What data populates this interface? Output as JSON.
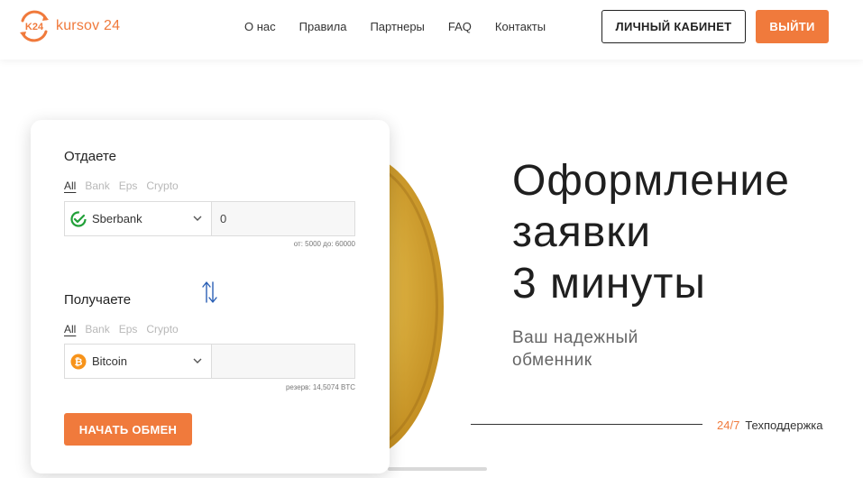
{
  "header": {
    "logo_badge": "K24",
    "logo_text": "kursov 24",
    "nav": [
      "О нас",
      "Правила",
      "Партнеры",
      "FAQ",
      "Контакты"
    ],
    "cabinet_label": "ЛИЧНЫЙ КАБИНЕТ",
    "logout_label": "ВЫЙТИ"
  },
  "exchange": {
    "give": {
      "title": "Отдаете",
      "tabs": [
        "All",
        "Bank",
        "Eps",
        "Crypto"
      ],
      "active_tab": "All",
      "currency": "Sberbank",
      "currency_icon": "sberbank-icon",
      "amount": "0",
      "hint": "от: 5000 до: 60000"
    },
    "get": {
      "title": "Получаете",
      "tabs": [
        "All",
        "Bank",
        "Eps",
        "Crypto"
      ],
      "active_tab": "All",
      "currency": "Bitcoin",
      "currency_icon": "bitcoin-icon",
      "amount": "",
      "hint": "резерв: 14,5074 BTC"
    },
    "swap_icon": "swap-arrows-icon",
    "start_label": "НАЧАТЬ ОБМЕН"
  },
  "hero": {
    "lines": [
      "Оформление",
      "заявки",
      "3 минуты"
    ],
    "subtitle_lines": [
      "Ваш надежный",
      "обменник"
    ]
  },
  "support": {
    "hours": "24/7",
    "label": "Техподдержка"
  },
  "colors": {
    "accent": "#f07a3c",
    "sber_green": "#21a038",
    "bitcoin": "#f7931a",
    "swap_blue": "#2a5fb5"
  }
}
